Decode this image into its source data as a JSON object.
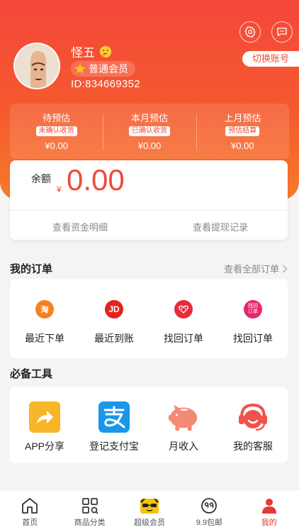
{
  "user": {
    "name": "怪五",
    "level": "普通会员",
    "id_text": "ID:834669352",
    "switch_account": "切换账号"
  },
  "estimates": [
    {
      "title": "待预估",
      "tag": "未确认收货",
      "value": "¥0.00"
    },
    {
      "title": "本月预估",
      "tag": "已确认收货",
      "value": "¥0.00"
    },
    {
      "title": "上月预估",
      "tag": "预估结算",
      "value": "¥0.00"
    }
  ],
  "balance": {
    "label": "余额",
    "currency": "¥",
    "amount": "0.00",
    "detail_link": "查看资金明细",
    "withdraw_link": "查看提现记录"
  },
  "orders": {
    "title": "我的订单",
    "view_all": "查看全部订单",
    "items": [
      {
        "label": "最近下单",
        "icon": "taobao-icon",
        "glyph": "淘",
        "color": "#f5821f"
      },
      {
        "label": "最近到账",
        "icon": "jd-icon",
        "glyph": "JD",
        "color": "#e4231e"
      },
      {
        "label": "找回订单",
        "icon": "tmall-icon",
        "glyph": "",
        "color": "#e92b3b"
      },
      {
        "label": "找回订单",
        "icon": "find-order-icon",
        "glyph": "找回\n订单",
        "color": "#e6286e"
      }
    ]
  },
  "tools": {
    "title": "必备工具",
    "items": [
      {
        "label": "APP分享",
        "icon": "share-icon",
        "color": "#f8b627"
      },
      {
        "label": "登记支付宝",
        "icon": "alipay-icon",
        "color": "#1c96e8"
      },
      {
        "label": "月收入",
        "icon": "piggy-bank-icon",
        "color": "#f38a75"
      },
      {
        "label": "我的客服",
        "icon": "customer-service-icon",
        "color": "#f0534b"
      }
    ]
  },
  "nav": {
    "items": [
      {
        "label": "首页",
        "icon": "home-icon"
      },
      {
        "label": "商品分类",
        "icon": "category-icon"
      },
      {
        "label": "超级会员",
        "icon": "super-member-icon"
      },
      {
        "label": "9.9包邮",
        "icon": "free-shipping-icon"
      },
      {
        "label": "我的",
        "icon": "profile-icon",
        "active": true
      }
    ]
  },
  "colors": {
    "accent": "#f04a3a",
    "header_top": "#f4473a",
    "header_bottom": "#f77a2a"
  }
}
